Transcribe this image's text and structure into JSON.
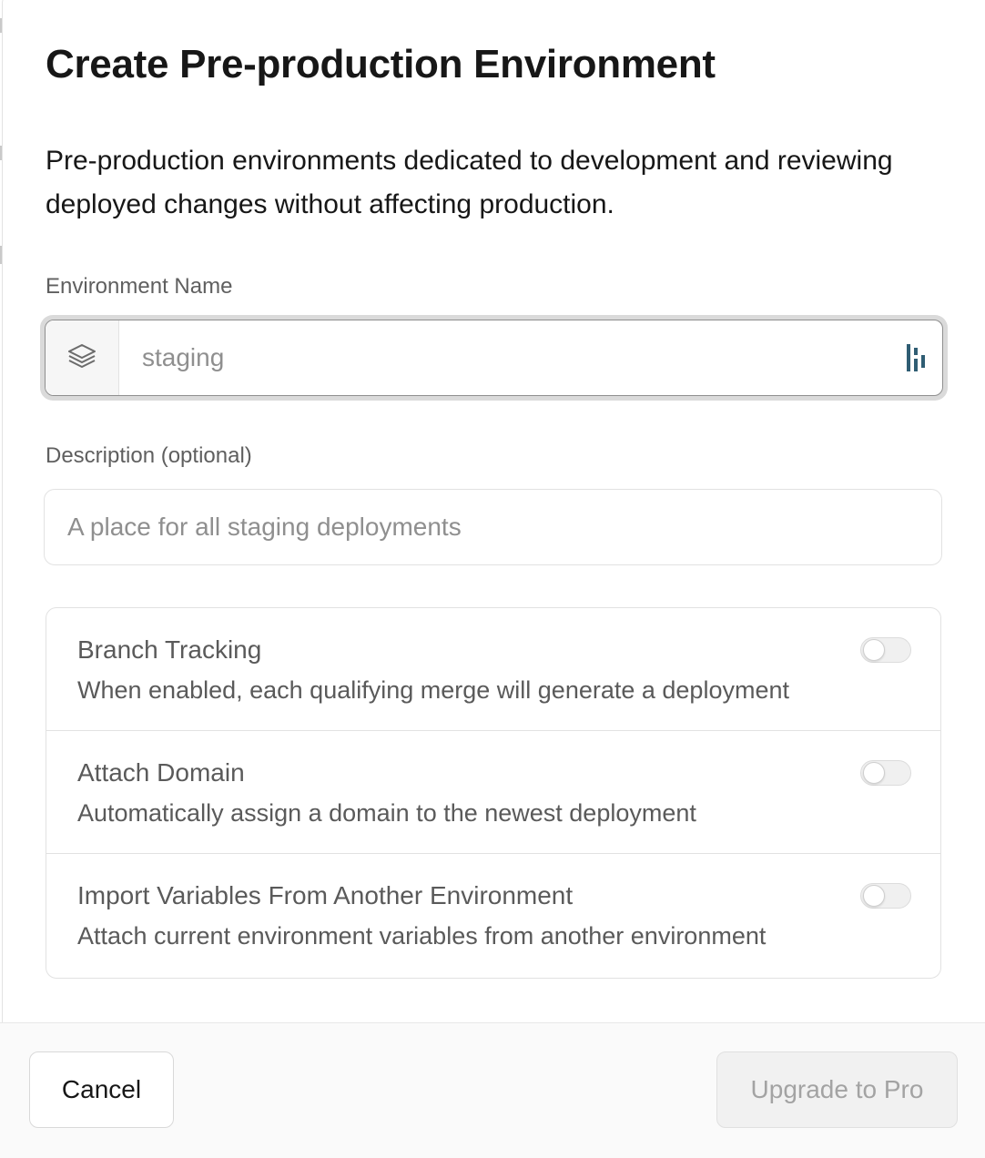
{
  "dialog": {
    "title": "Create Pre-production Environment",
    "description": "Pre-production environments dedicated to development and reviewing deployed changes without affecting production."
  },
  "environment_name": {
    "label": "Environment Name",
    "placeholder": "staging",
    "value": "",
    "prefix_icon": "layers-icon",
    "suffix_icon": "password-manager-icon"
  },
  "description_field": {
    "label": "Description (optional)",
    "placeholder": "A place for all staging deployments",
    "value": ""
  },
  "options": [
    {
      "title": "Branch Tracking",
      "subtitle": "When enabled, each qualifying merge will generate a deployment",
      "enabled": false
    },
    {
      "title": "Attach Domain",
      "subtitle": "Automatically assign a domain to the newest deployment",
      "enabled": false
    },
    {
      "title": "Import Variables From Another Environment",
      "subtitle": "Attach current environment variables from another environment",
      "enabled": false
    }
  ],
  "footer": {
    "cancel_label": "Cancel",
    "upgrade_label": "Upgrade to Pro"
  },
  "colors": {
    "text": "#171717",
    "muted": "#5a5a5a",
    "placeholder": "#8f8f8f",
    "border": "#e2e2e2",
    "disabled_button_bg": "#f1f1f1",
    "disabled_button_text": "#a3a3a3"
  }
}
